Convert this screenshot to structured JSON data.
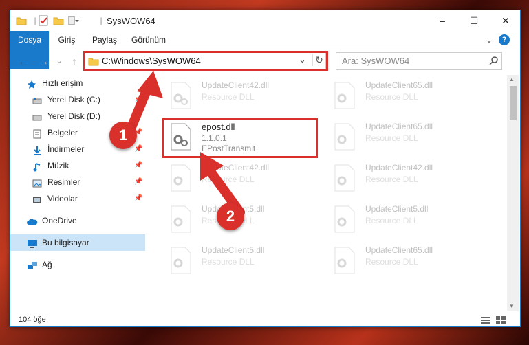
{
  "window": {
    "title": "SysWOW64",
    "controls": {
      "minimize": "–",
      "maximize": "☐",
      "close": "✕"
    }
  },
  "ribbon": {
    "tabs": [
      {
        "label": "Dosya"
      },
      {
        "label": "Giriş"
      },
      {
        "label": "Paylaş"
      },
      {
        "label": "Görünüm"
      }
    ],
    "expand": "⌄",
    "help": "?"
  },
  "nav": {
    "back": "←",
    "forward": "→",
    "dropdown": "⌄",
    "up": "↑",
    "address": "C:\\Windows\\SysWOW64",
    "address_dropdown": "⌄",
    "refresh": "↻",
    "search_placeholder": "Ara: SysWOW64"
  },
  "sidebar": {
    "items": [
      {
        "label": "Hızlı erişim"
      },
      {
        "label": "Yerel Disk (C:)"
      },
      {
        "label": "Yerel Disk (D:)"
      },
      {
        "label": "Belgeler"
      },
      {
        "label": "İndirmeler"
      },
      {
        "label": "Müzik"
      },
      {
        "label": "Resimler"
      },
      {
        "label": "Videolar"
      },
      {
        "label": "OneDrive"
      },
      {
        "label": "Bu bilgisayar"
      },
      {
        "label": "Ağ"
      }
    ]
  },
  "files": {
    "col1": [
      {
        "name": "UpdateClient42.dll",
        "sub": "Resource DLL"
      },
      {
        "name": "epost.dll",
        "sub": "1.1.0.1",
        "sub2": "EPostTransmit"
      },
      {
        "name": "UpdateClient42.dll",
        "sub": "Resource DLL"
      },
      {
        "name": "UpdateClient5.dll",
        "sub": "Resource DLL"
      },
      {
        "name": "UpdateClient5.dll",
        "sub": "Resource DLL"
      }
    ],
    "col2": [
      {
        "name": "UpdateClient65.dll",
        "sub": "Resource DLL"
      },
      {
        "name": "UpdateClient65.dll",
        "sub": "Resource DLL"
      },
      {
        "name": "UpdateClient42.dll",
        "sub": "Resource DLL"
      },
      {
        "name": "UpdateClient5.dll",
        "sub": "Resource DLL"
      },
      {
        "name": "UpdateClient65.dll",
        "sub": "Resource DLL"
      }
    ]
  },
  "status": {
    "count": "104 öğe"
  },
  "annotations": {
    "step1": "1",
    "step2": "2"
  },
  "colors": {
    "accent": "#1979ca",
    "highlight": "#d9302c"
  }
}
